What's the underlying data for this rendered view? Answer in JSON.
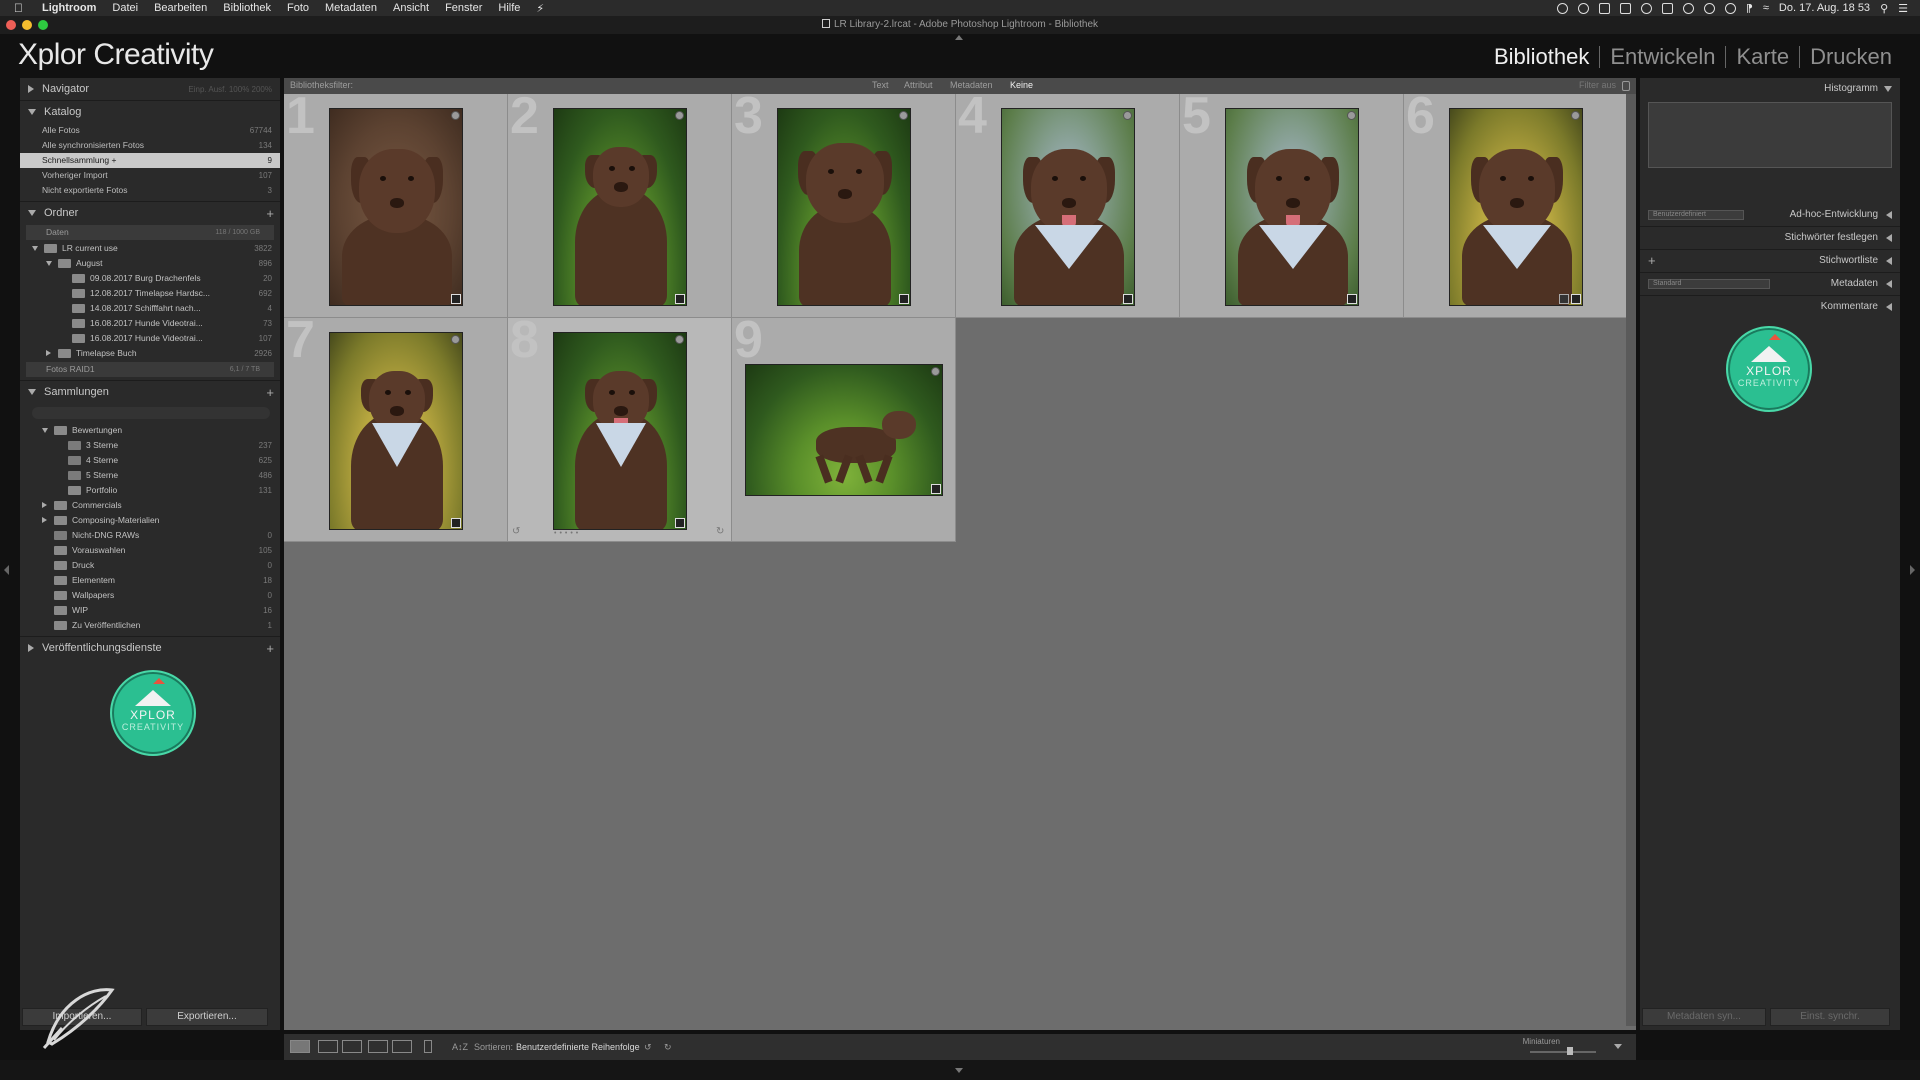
{
  "menubar": {
    "app": "Lightroom",
    "items": [
      "Datei",
      "Bearbeiten",
      "Bibliothek",
      "Foto",
      "Metadaten",
      "Ansicht",
      "Fenster",
      "Hilfe"
    ],
    "datetime": "Do. 17. Aug. 18 53"
  },
  "window": {
    "title": "LR Library-2.lrcat - Adobe Photoshop Lightroom - Bibliothek"
  },
  "identity_plate": "Xplor Creativity",
  "modules": [
    {
      "label": "Bibliothek",
      "active": true
    },
    {
      "label": "Entwickeln",
      "active": false
    },
    {
      "label": "Karte",
      "active": false
    },
    {
      "label": "Drucken",
      "active": false
    }
  ],
  "left_panel": {
    "navigator": {
      "title": "Navigator",
      "options": "Einp.  Ausf.  100%  200%"
    },
    "catalog": {
      "title": "Katalog",
      "items": [
        {
          "label": "Alle Fotos",
          "count": "67744",
          "selected": false
        },
        {
          "label": "Alle synchronisierten Fotos",
          "count": "134",
          "selected": false
        },
        {
          "label": "Schnellsammlung +",
          "count": "9",
          "selected": true
        },
        {
          "label": "Vorheriger Import",
          "count": "107",
          "selected": false
        },
        {
          "label": "Nicht exportierte Fotos",
          "count": "3",
          "selected": false
        }
      ]
    },
    "folders": {
      "title": "Ordner",
      "volume1": {
        "label": "Daten",
        "size": "118 / 1000 GB"
      },
      "tree": [
        {
          "label": "LR current use",
          "count": "3822",
          "level": 0,
          "expanded": true
        },
        {
          "label": "August",
          "count": "896",
          "level": 1,
          "expanded": true
        },
        {
          "label": "09.08.2017 Burg Drachenfels",
          "count": "20",
          "level": 2
        },
        {
          "label": "12.08.2017 Timelapse Hardsc...",
          "count": "692",
          "level": 2
        },
        {
          "label": "14.08.2017 Schifffahrt nach...",
          "count": "4",
          "level": 2
        },
        {
          "label": "16.08.2017 Hunde Videotrai...",
          "count": "73",
          "level": 2
        },
        {
          "label": "16.08.2017 Hunde Videotrai...",
          "count": "107",
          "level": 2
        },
        {
          "label": "Timelapse Buch",
          "count": "2926",
          "level": 1,
          "expanded": false
        }
      ],
      "volume2": {
        "label": "Fotos RAID1",
        "size": "6,1 / 7 TB"
      }
    },
    "collections": {
      "title": "Sammlungen",
      "tree": [
        {
          "label": "Bewertungen",
          "count": "",
          "level": 0,
          "expanded": true,
          "type": "set"
        },
        {
          "label": "3 Sterne",
          "count": "237",
          "level": 1,
          "type": "smart"
        },
        {
          "label": "4 Sterne",
          "count": "625",
          "level": 1,
          "type": "smart"
        },
        {
          "label": "5 Sterne",
          "count": "486",
          "level": 1,
          "type": "smart"
        },
        {
          "label": "Portfolio",
          "count": "131",
          "level": 1,
          "type": "coll"
        },
        {
          "label": "Commercials",
          "count": "",
          "level": 0,
          "expanded": false,
          "type": "set"
        },
        {
          "label": "Composing-Materialien",
          "count": "",
          "level": 0,
          "expanded": false,
          "type": "set"
        },
        {
          "label": "Nicht-DNG RAWs",
          "count": "0",
          "level": 0,
          "type": "smart"
        },
        {
          "label": "Vorauswahlen",
          "count": "105",
          "level": 0,
          "type": "coll"
        },
        {
          "label": "Druck",
          "count": "0",
          "level": 0,
          "type": "coll"
        },
        {
          "label": "Elementem",
          "count": "18",
          "level": 0,
          "type": "coll"
        },
        {
          "label": "Wallpapers",
          "count": "0",
          "level": 0,
          "type": "coll"
        },
        {
          "label": "WIP",
          "count": "16",
          "level": 0,
          "type": "coll"
        },
        {
          "label": "Zu Veröffentlichen",
          "count": "1",
          "level": 0,
          "type": "coll"
        }
      ]
    },
    "publish": {
      "title": "Veröffentlichungsdienste"
    },
    "logo": {
      "line1": "XPLOR",
      "line2": "CREATIVITY"
    },
    "import_button": "Importieren...",
    "export_button": "Exportieren..."
  },
  "filterbar": {
    "label": "Bibliotheksfilter:",
    "tabs": [
      {
        "label": "Text",
        "active": false
      },
      {
        "label": "Attribut",
        "active": false
      },
      {
        "label": "Metadaten",
        "active": false
      },
      {
        "label": "Keine",
        "active": true
      }
    ],
    "filter_off": "Filter aus"
  },
  "grid": {
    "cells": [
      {
        "index": "1",
        "scene": "brown",
        "pose": "portrait",
        "scarf": false,
        "tongue": false
      },
      {
        "index": "2",
        "scene": "green",
        "pose": "lying",
        "scarf": false,
        "tongue": false
      },
      {
        "index": "3",
        "scene": "green",
        "pose": "lying-close",
        "scarf": false,
        "tongue": false
      },
      {
        "index": "4",
        "scene": "blue",
        "pose": "portrait",
        "scarf": true,
        "tongue": true
      },
      {
        "index": "5",
        "scene": "blue",
        "pose": "portrait",
        "scarf": true,
        "tongue": true
      },
      {
        "index": "6",
        "scene": "yellow",
        "pose": "portrait",
        "scarf": true,
        "tongue": false
      },
      {
        "index": "7",
        "scene": "yellow",
        "pose": "sitting",
        "scarf": true,
        "tongue": false
      },
      {
        "index": "8",
        "scene": "green",
        "pose": "sitting",
        "scarf": true,
        "tongue": true
      },
      {
        "index": "9",
        "scene": "green",
        "pose": "running",
        "scarf": false,
        "tongue": false
      }
    ]
  },
  "toolbar": {
    "sort_label": "Sortieren:",
    "sort_value": "Benutzerdefinierte Reihenfolge",
    "thumbs_label": "Miniaturen",
    "thumb_size": 0.6
  },
  "right_panel": {
    "histogram": "Histogramm",
    "quick_develop": "Ad-hoc-Entwicklung",
    "quick_develop_preset": "Benutzerdefiniert",
    "keywording": "Stichwörter festlegen",
    "keyword_list": "Stichwortliste",
    "metadata": "Metadaten",
    "metadata_preset": "Standard",
    "comments": "Kommentare",
    "logo": {
      "line1": "XPLOR",
      "line2": "CREATIVITY"
    },
    "sync_meta_button": "Metadaten syn...",
    "sync_settings_button": "Einst. synchr."
  },
  "colors": {
    "logo_teal": "#2bbf91",
    "logo_peak": "#e8543e",
    "grid_bg": "#6d6d6d",
    "cell_bg": "#ababab"
  }
}
